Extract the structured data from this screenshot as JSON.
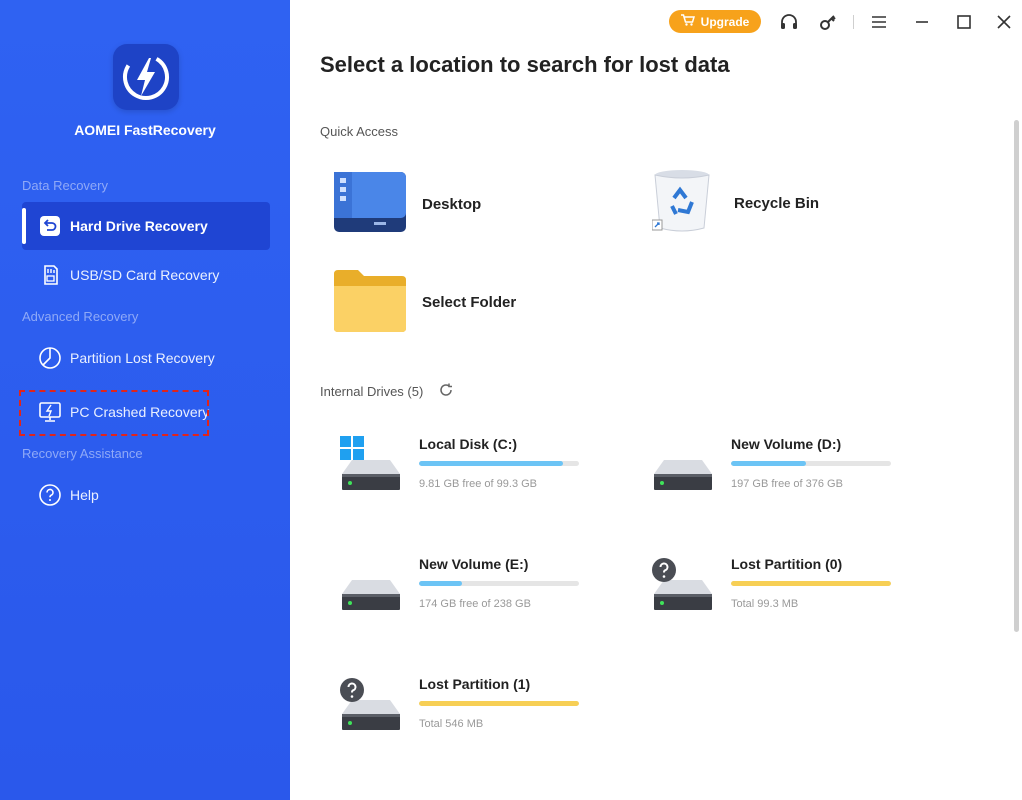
{
  "app": {
    "name": "AOMEI FastRecovery"
  },
  "sidebar": {
    "sections": {
      "data_recovery": "Data Recovery",
      "advanced_recovery": "Advanced Recovery",
      "recovery_assistance": "Recovery Assistance"
    },
    "items": [
      {
        "label": "Hard Drive Recovery",
        "icon": "hard-drive-recovery-icon",
        "active": true
      },
      {
        "label": "USB/SD Card Recovery",
        "icon": "sd-card-icon"
      },
      {
        "label": "Partition Lost Recovery",
        "icon": "partition-icon"
      },
      {
        "label": "PC Crashed Recovery",
        "icon": "pc-crashed-icon",
        "highlighted": true
      },
      {
        "label": "Help",
        "icon": "help-icon"
      }
    ]
  },
  "topbar": {
    "upgrade_label": "Upgrade"
  },
  "main": {
    "title": "Select a location to search for lost data",
    "quick_access_label": "Quick Access",
    "quick_access": [
      {
        "label": "Desktop",
        "icon": "desktop-folder-icon"
      },
      {
        "label": "Recycle Bin",
        "icon": "recycle-bin-icon"
      },
      {
        "label": "Select Folder",
        "icon": "folder-icon"
      }
    ],
    "internal_drives_label": "Internal Drives (5)",
    "drives": [
      {
        "name": "Local Disk (C:)",
        "info": "9.81 GB free of 99.3 GB",
        "used_fraction": 0.9,
        "bar_color": "#6cc4f5",
        "badge": "windows"
      },
      {
        "name": "New Volume (D:)",
        "info": "197 GB free of 376 GB",
        "used_fraction": 0.47,
        "bar_color": "#6cc4f5"
      },
      {
        "name": "New Volume (E:)",
        "info": "174 GB free of 238 GB",
        "used_fraction": 0.27,
        "bar_color": "#6cc4f5"
      },
      {
        "name": "Lost Partition (0)",
        "info": "Total 99.3 MB",
        "used_fraction": 1.0,
        "bar_color": "#f7cf55",
        "badge": "question"
      },
      {
        "name": "Lost Partition (1)",
        "info": "Total 546 MB",
        "used_fraction": 1.0,
        "bar_color": "#f7cf55",
        "badge": "question"
      }
    ]
  },
  "colors": {
    "sidebar": "#2d5ef0",
    "accent": "#f7a21b",
    "highlight_border": "#e0241b"
  }
}
